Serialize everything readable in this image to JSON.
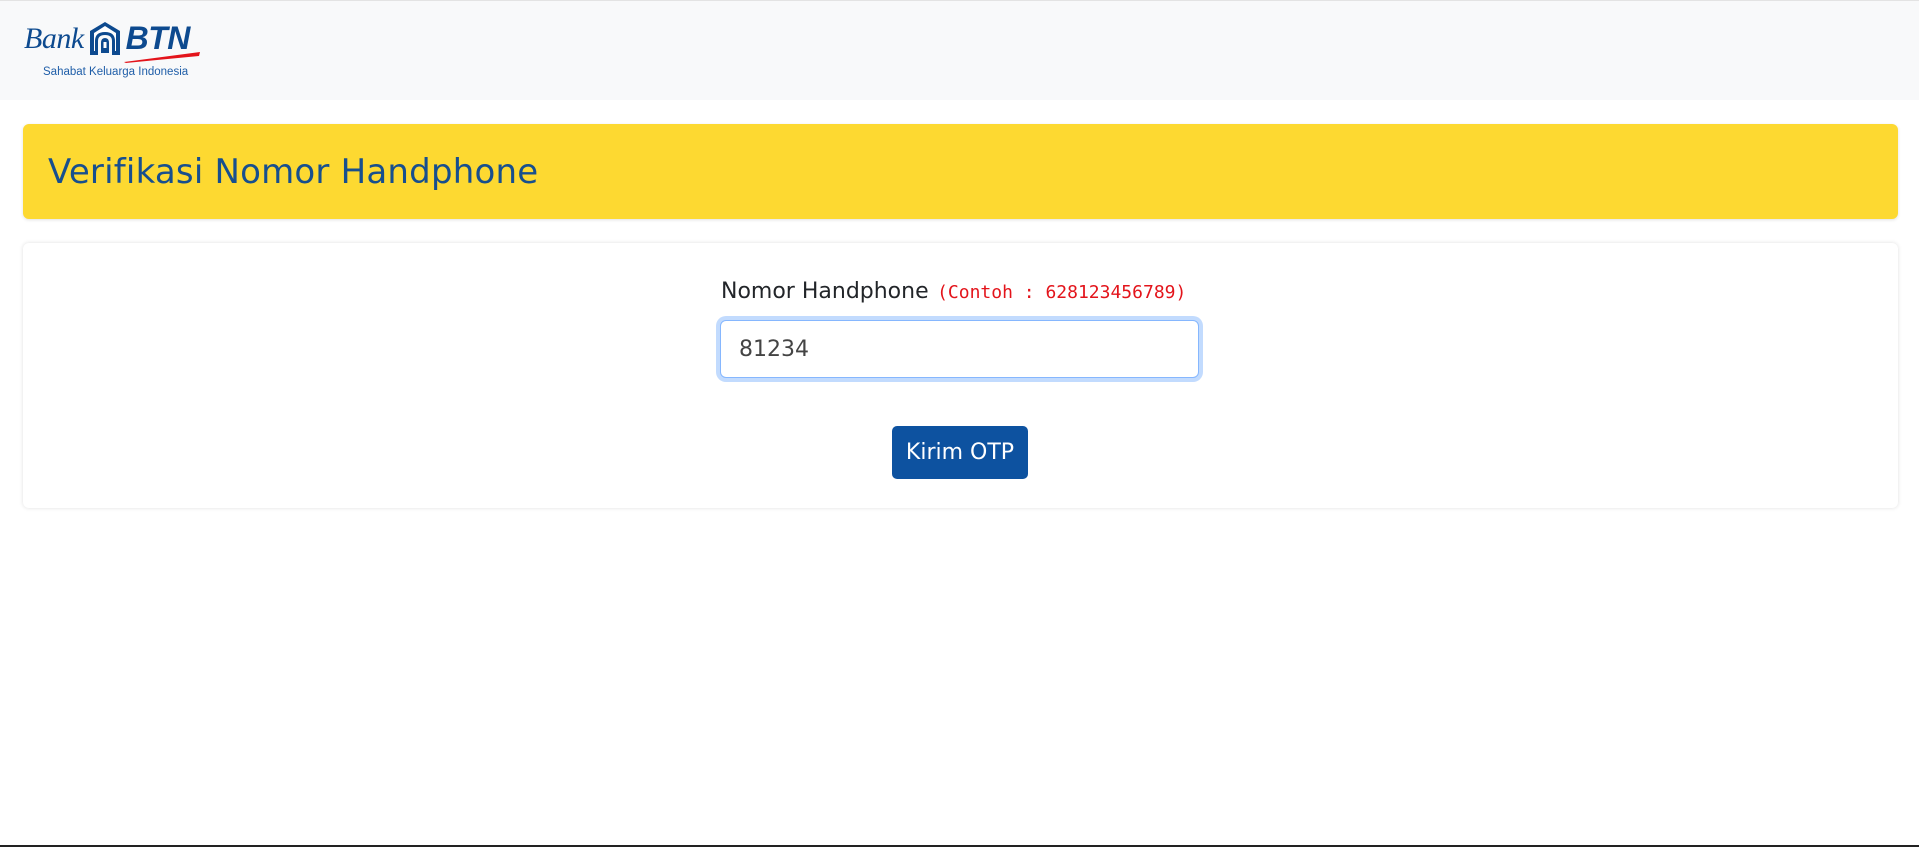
{
  "navbar": {
    "logo": {
      "bank_text": "Bank",
      "brand_text": "BTN",
      "tagline": "Sahabat Keluarga Indonesia"
    }
  },
  "header": {
    "title": "Verifikasi Nomor Handphone"
  },
  "form": {
    "phone_label": "Nomor Handphone",
    "phone_hint": "(Contoh : 628123456789)",
    "phone_value": "81234",
    "submit_label": "Kirim OTP"
  },
  "colors": {
    "brand_blue": "#0d52a0",
    "header_yellow": "#fdd931",
    "title_blue": "#174f8e",
    "hint_red": "#e3141b",
    "logo_red": "#e3141b"
  }
}
